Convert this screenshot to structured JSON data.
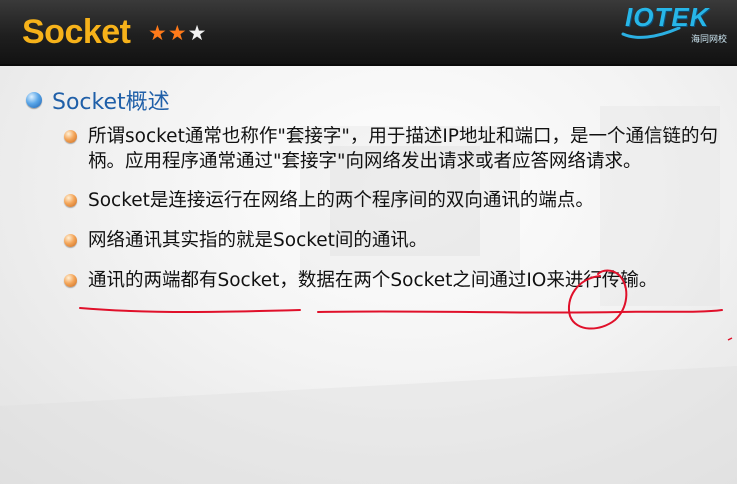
{
  "header": {
    "title": "Socket",
    "stars": {
      "filled": 2,
      "total": 3
    },
    "logo": {
      "text": "IOTEK",
      "subtitle": "海同网校"
    }
  },
  "main": {
    "heading": "Socket概述",
    "items": [
      "所谓socket通常也称作\"套接字\"，用于描述IP地址和端口，是一个通信链的句柄。应用程序通常通过\"套接字\"向网络发出请求或者应答网络请求。",
      "Socket是连接运行在网络上的两个程序间的双向通讯的端点。",
      "网络通讯其实指的就是Socket间的通讯。",
      "通讯的两端都有Socket，数据在两个Socket之间通过IO来进行传输。"
    ]
  },
  "colors": {
    "title": "#f6b21a",
    "heading": "#1f5fa8",
    "annotation": "#e0102a"
  }
}
